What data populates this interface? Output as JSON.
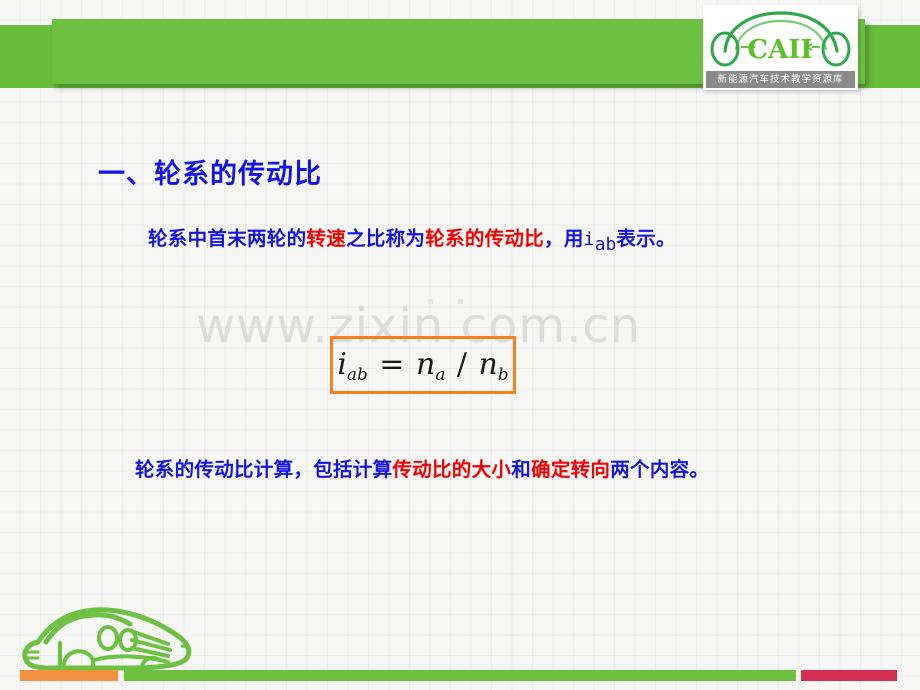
{
  "slide": {
    "background_color": "#f6f6f4",
    "grid": true
  },
  "header": {
    "band_color": "#6cc042",
    "band_shadow_color": "#68bd3d"
  },
  "logo": {
    "name": "caii-logo",
    "wordmark": "CAII",
    "caption": "新能源汽车技术教学资源库",
    "car_outline_color": "#2fa84a",
    "wordmark_color": "#5cc02a",
    "caption_bar_color": "#8a8a8a"
  },
  "content": {
    "section_title": "一、轮系的传动比",
    "title_color": "#1414e6",
    "highlight_color": "#f40000",
    "definition": {
      "prefix": "轮系中首末两轮的",
      "highlight_1": "转速",
      "middle": "之比称为",
      "highlight_2": "轮系的传动比",
      "suffix_before_symbol": "，用",
      "symbol_base": "i",
      "symbol_sub": "ab",
      "suffix_after_symbol": "表示。"
    },
    "scope": {
      "prefix": "轮系的传动比计算，包括计算",
      "highlight_1": "传动比的大小",
      "middle": "和",
      "highlight_2": "确定转向",
      "suffix": "两个内容。"
    }
  },
  "formula": {
    "lhs_base": "i",
    "lhs_sub": "ab",
    "equals": "=",
    "num_base": "n",
    "num_sub": "a",
    "divide": "/",
    "den_base": "n",
    "den_sub": "b",
    "border_color": "#f4801e"
  },
  "watermark": {
    "text": "www.zixin.com.cn",
    "color": "#dcdcdc"
  },
  "footer": {
    "car_color": "#6cc042",
    "rule_orange_color": "#f2923f",
    "rule_green_color": "#6cc042",
    "rule_red_color": "#d62e52"
  }
}
